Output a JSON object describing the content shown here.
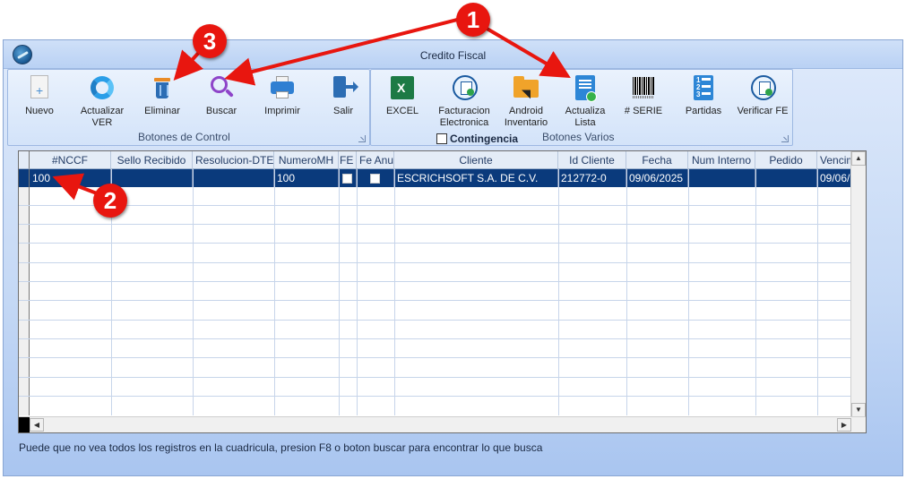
{
  "window": {
    "title": "Credito Fiscal"
  },
  "groups": {
    "control": {
      "title": "Botones de Control",
      "buttons": [
        {
          "icon": "new-document-icon",
          "label": "Nuevo"
        },
        {
          "icon": "refresh-icon",
          "label": "Actualizar\nVER"
        },
        {
          "icon": "trash-icon",
          "label": "Eliminar"
        },
        {
          "icon": "search-icon",
          "label": "Buscar"
        },
        {
          "icon": "printer-icon",
          "label": "Imprimir"
        },
        {
          "icon": "exit-icon",
          "label": "Salir"
        }
      ]
    },
    "varios": {
      "title": "Botones Varios",
      "buttons": [
        {
          "icon": "excel-icon",
          "label": "EXCEL"
        },
        {
          "icon": "facturacion-seal-icon",
          "label": "Facturacion\nElectronica"
        },
        {
          "icon": "android-folder-icon",
          "label": "Android\nInventario"
        },
        {
          "icon": "update-list-icon",
          "label": "Actualiza\nLista"
        },
        {
          "icon": "barcode-icon",
          "label": "# SERIE"
        },
        {
          "icon": "numbered-list-icon",
          "label": "Partidas"
        },
        {
          "icon": "verify-seal-icon",
          "label": "Verificar FE"
        }
      ],
      "contingencia_label": "Contingencia",
      "contingencia_checked": false
    }
  },
  "grid": {
    "columns": [
      "#NCCF",
      "Sello Recibido",
      "Resolucion-DTE",
      "NumeroMH",
      "FE",
      "Fe Anu",
      "Cliente",
      "Id Cliente",
      "Fecha",
      "Num Interno",
      "Pedido",
      "Vencim"
    ],
    "rows": [
      [
        "100",
        "",
        "",
        "100",
        "",
        "",
        "ESCRICHSOFT S.A. DE C.V.",
        "212772-0",
        "09/06/2025",
        "",
        "",
        "09/06/"
      ]
    ],
    "row_checkboxes": {
      "FE": false,
      "Fe Anu": false
    }
  },
  "status_message": "Puede que no vea todos los registros en la cuadricula, presion F8 o boton buscar para encontrar lo que busca",
  "annotations": {
    "badges": [
      "1",
      "2",
      "3"
    ],
    "color": "#e8160f"
  }
}
